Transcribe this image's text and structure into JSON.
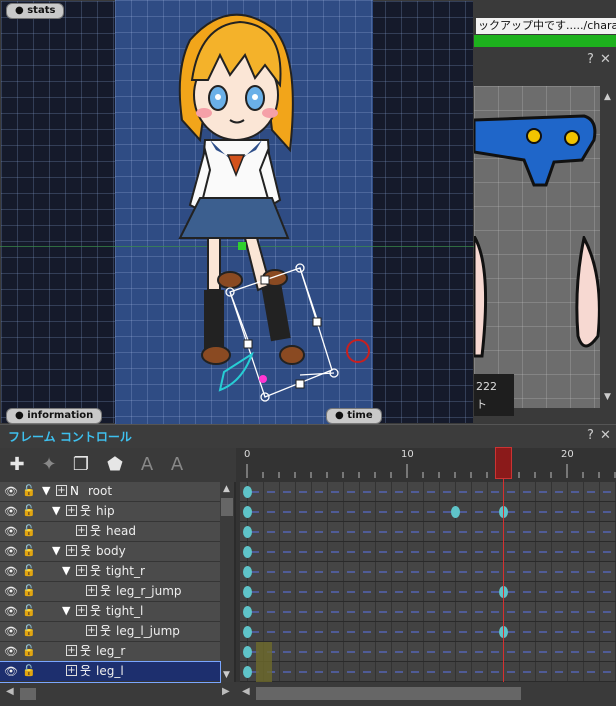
{
  "viewport": {
    "labels": {
      "stats": "stats",
      "information": "information",
      "time": "time"
    }
  },
  "right_panel": {
    "progress_text": "ックアップ中です...../character_tem",
    "help_label": "?",
    "close_label": "✕",
    "overlay_number": "222",
    "overlay_text": "ト"
  },
  "frame_control": {
    "title": "フレーム コントロール",
    "help_label": "?",
    "close_label": "✕",
    "tools": [
      "add-bone-icon",
      "add-star-icon",
      "copy-frame-icon",
      "shield-icon",
      "text-a-icon",
      "text-a-rotate-icon"
    ],
    "frame_ruler": {
      "labels": [
        "0",
        "10",
        "20"
      ],
      "current_frame": 16
    },
    "layers": [
      {
        "name": "root",
        "indent": 0,
        "expanded": true,
        "type": "null",
        "prefix": "N"
      },
      {
        "name": "hip",
        "indent": 1,
        "expanded": true,
        "type": "bone"
      },
      {
        "name": "head",
        "indent": 2,
        "expanded": null,
        "type": "bone"
      },
      {
        "name": "body",
        "indent": 1,
        "expanded": true,
        "type": "bone"
      },
      {
        "name": "tight_r",
        "indent": 2,
        "expanded": true,
        "type": "bone"
      },
      {
        "name": "leg_r_jump",
        "indent": 3,
        "expanded": null,
        "type": "bone"
      },
      {
        "name": "tight_l",
        "indent": 2,
        "expanded": true,
        "type": "bone"
      },
      {
        "name": "leg_l_jump",
        "indent": 3,
        "expanded": null,
        "type": "bone"
      },
      {
        "name": "leg_r",
        "indent": 1,
        "expanded": null,
        "type": "bone"
      },
      {
        "name": "leg_l",
        "indent": 1,
        "expanded": null,
        "type": "bone",
        "selected": true
      }
    ],
    "keyframes": [
      [
        0
      ],
      [
        0,
        13,
        16
      ],
      [
        0
      ],
      [
        0
      ],
      [
        0
      ],
      [
        0,
        16
      ],
      [
        0
      ],
      [
        0,
        16
      ],
      [
        0
      ],
      [
        0
      ]
    ]
  },
  "colors": {
    "accent": "#3ec0ee",
    "progress": "#1db11d",
    "keyframe": "#5fc4c9",
    "playhead": "#8b1a1a",
    "selection": "#1d2f6e"
  }
}
